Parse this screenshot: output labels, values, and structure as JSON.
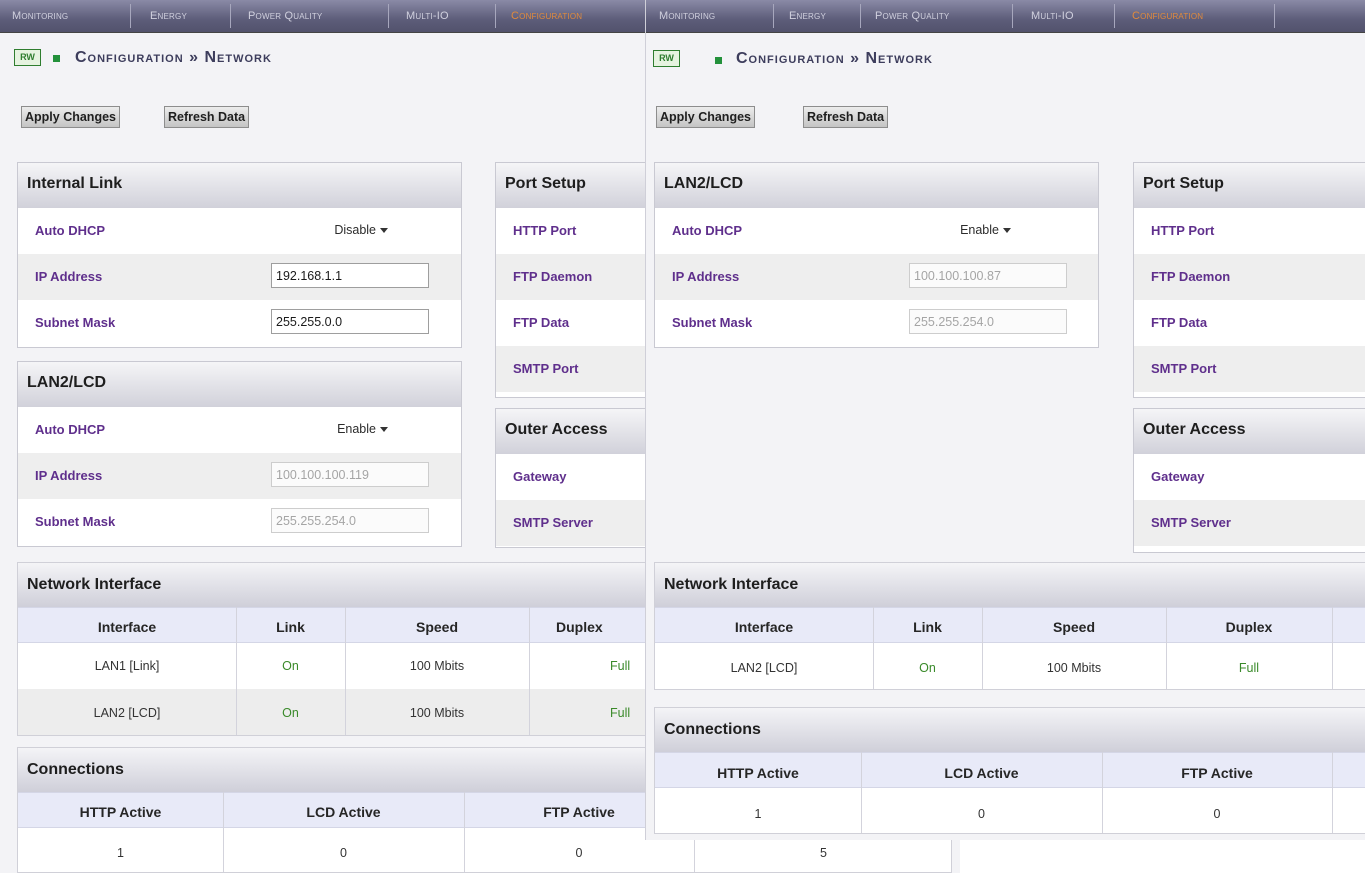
{
  "nav": {
    "items": [
      "Monitoring",
      "Energy",
      "Power Quality",
      "Multi-IO",
      "Configuration"
    ],
    "active": "Configuration"
  },
  "page": {
    "rw_badge": "RW",
    "title": "Configuration » Network"
  },
  "toolbar": {
    "apply_label": "Apply Changes",
    "refresh_label": "Refresh Data"
  },
  "left": {
    "internal_link": {
      "title": "Internal Link",
      "auto_dhcp_label": "Auto DHCP",
      "auto_dhcp_value": "Disable",
      "ip_label": "IP Address",
      "ip_value": "192.168.1.1",
      "mask_label": "Subnet Mask",
      "mask_value": "255.255.0.0"
    },
    "lan2": {
      "title": "LAN2/LCD",
      "auto_dhcp_label": "Auto DHCP",
      "auto_dhcp_value": "Enable",
      "ip_label": "IP Address",
      "ip_value": "100.100.100.119",
      "mask_label": "Subnet Mask",
      "mask_value": "255.255.254.0"
    },
    "port_setup": {
      "title": "Port Setup",
      "rows": [
        "HTTP Port",
        "FTP Daemon",
        "FTP Data",
        "SMTP Port"
      ]
    },
    "outer_access": {
      "title": "Outer Access",
      "rows": [
        "Gateway",
        "SMTP Server"
      ]
    },
    "network_interface": {
      "title": "Network Interface",
      "headers": [
        "Interface",
        "Link",
        "Speed",
        "Duplex"
      ],
      "rows": [
        [
          "LAN1 [Link]",
          "On",
          "100 Mbits",
          "Full"
        ],
        [
          "LAN2 [LCD]",
          "On",
          "100 Mbits",
          "Full"
        ]
      ]
    },
    "connections": {
      "title": "Connections",
      "headers": [
        "HTTP Active",
        "LCD Active",
        "FTP Active"
      ],
      "values": [
        "1",
        "0",
        "0",
        "5"
      ]
    }
  },
  "right": {
    "lan2": {
      "title": "LAN2/LCD",
      "auto_dhcp_label": "Auto DHCP",
      "auto_dhcp_value": "Enable",
      "ip_label": "IP Address",
      "ip_value": "100.100.100.87",
      "mask_label": "Subnet Mask",
      "mask_value": "255.255.254.0"
    },
    "port_setup": {
      "title": "Port Setup",
      "rows": [
        "HTTP Port",
        "FTP Daemon",
        "FTP Data",
        "SMTP Port"
      ]
    },
    "outer_access": {
      "title": "Outer Access",
      "rows": [
        "Gateway",
        "SMTP Server"
      ]
    },
    "network_interface": {
      "title": "Network Interface",
      "headers": [
        "Interface",
        "Link",
        "Speed",
        "Duplex"
      ],
      "rows": [
        [
          "LAN2 [LCD]",
          "On",
          "100 Mbits",
          "Full"
        ]
      ]
    },
    "connections": {
      "title": "Connections",
      "headers": [
        "HTTP Active",
        "LCD Active",
        "FTP Active"
      ],
      "values": [
        "1",
        "0",
        "0"
      ]
    }
  }
}
